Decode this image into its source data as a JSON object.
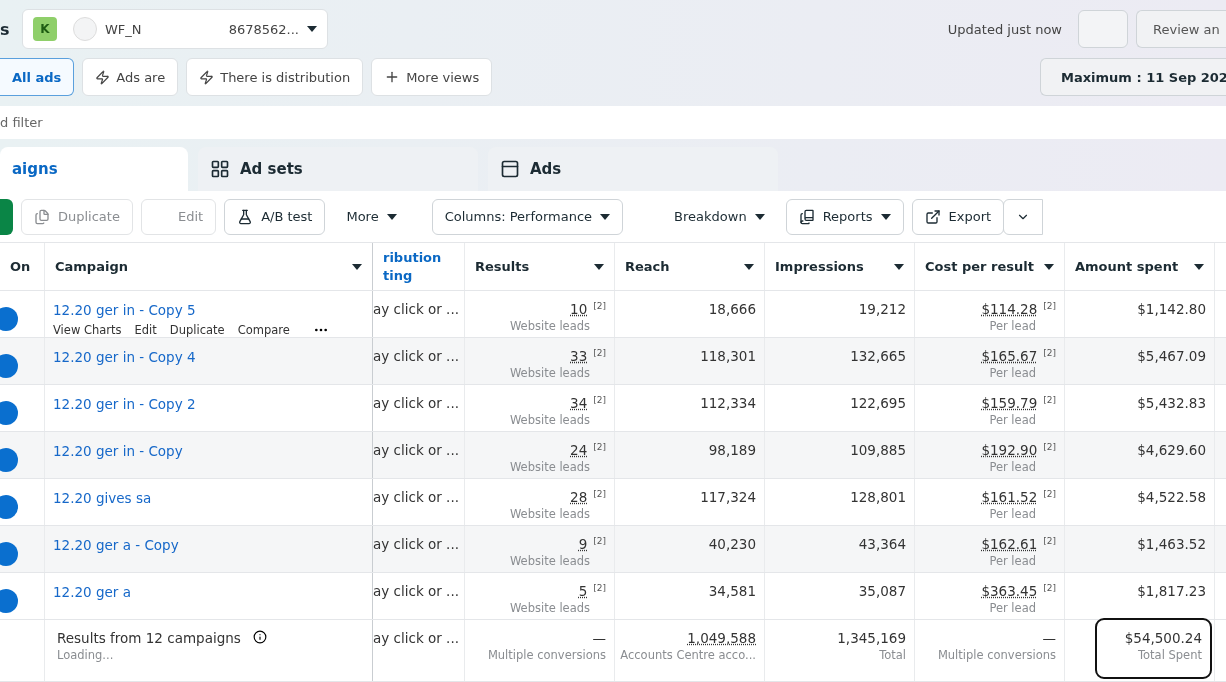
{
  "header": {
    "section_title": "s",
    "account": {
      "initial": "K",
      "name_start": "WF_N",
      "name_end": "8678562..."
    },
    "updated": "Updated just now",
    "review_button": "Review an"
  },
  "views": [
    {
      "label": "All ads",
      "kind": "plain",
      "selected": true
    },
    {
      "label": "Ads are",
      "kind": "bolt",
      "selected": false
    },
    {
      "label": "There is distribution",
      "kind": "bolt",
      "selected": false
    },
    {
      "label": "More views",
      "kind": "plus",
      "selected": false
    }
  ],
  "date_button": "Maximum : 11 Sep 202",
  "filter": {
    "placeholder": "d filter"
  },
  "tabs": [
    {
      "label": "aigns",
      "kind": "campaigns",
      "selected": true
    },
    {
      "label": "Ad sets",
      "kind": "adsets",
      "selected": false
    },
    {
      "label": "Ads",
      "kind": "ads",
      "selected": false
    }
  ],
  "toolbar": [
    {
      "kind": "create"
    },
    {
      "kind": "duplicate",
      "label": "Duplicate",
      "disabled": true
    },
    {
      "kind": "edit",
      "label": "Edit",
      "disabled": true
    },
    {
      "kind": "abtest",
      "label": "A/B test",
      "disabled": false
    },
    {
      "kind": "more",
      "label": "More",
      "disabled": false
    },
    {
      "kind": "columns",
      "label": "Columns: Performance",
      "disabled": false
    },
    {
      "kind": "breakdown",
      "label": "Breakdown",
      "disabled": false
    },
    {
      "kind": "reports",
      "label": "Reports",
      "disabled": false
    },
    {
      "kind": "export",
      "label": "Export",
      "disabled": false
    }
  ],
  "table": {
    "columns": [
      "On",
      "Campaign",
      "ribution ting",
      "Results",
      "Reach",
      "Impressions",
      "Cost per result",
      "Amount spent"
    ],
    "rows": [
      {
        "on": true,
        "campaign": "12.20 ger in - Copy 5",
        "actions": [
          "View Charts",
          "Edit",
          "Duplicate",
          "Compare"
        ],
        "attribution": "ay click or ...",
        "results": "10",
        "results_note": "[2]",
        "results_type": "Website leads",
        "reach": "18,666",
        "impressions": "19,212",
        "cost": "$114.28",
        "cost_note": "[2]",
        "cost_type": "Per lead",
        "spent": "$1,142.80"
      },
      {
        "on": true,
        "campaign": "12.20 ger in - Copy 4",
        "attribution": "ay click or ...",
        "results": "33",
        "results_note": "[2]",
        "results_type": "Website leads",
        "reach": "118,301",
        "impressions": "132,665",
        "cost": "$165.67",
        "cost_note": "[2]",
        "cost_type": "Per lead",
        "spent": "$5,467.09"
      },
      {
        "on": true,
        "campaign": "12.20 ger in - Copy 2",
        "attribution": "ay click or ...",
        "results": "34",
        "results_note": "[2]",
        "results_type": "Website leads",
        "reach": "112,334",
        "impressions": "122,695",
        "cost": "$159.79",
        "cost_note": "[2]",
        "cost_type": "Per lead",
        "spent": "$5,432.83"
      },
      {
        "on": true,
        "campaign": "12.20 ger in - Copy",
        "attribution": "ay click or ...",
        "results": "24",
        "results_note": "[2]",
        "results_type": "Website leads",
        "reach": "98,189",
        "impressions": "109,885",
        "cost": "$192.90",
        "cost_note": "[2]",
        "cost_type": "Per lead",
        "spent": "$4,629.60"
      },
      {
        "on": true,
        "campaign": "12.20 gives sa",
        "attribution": "ay click or ...",
        "results": "28",
        "results_note": "[2]",
        "results_type": "Website leads",
        "reach": "117,324",
        "impressions": "128,801",
        "cost": "$161.52",
        "cost_note": "[2]",
        "cost_type": "Per lead",
        "spent": "$4,522.58"
      },
      {
        "on": true,
        "campaign": "12.20 ger a - Copy",
        "attribution": "ay click or ...",
        "results": "9",
        "results_note": "[2]",
        "results_type": "Website leads",
        "reach": "40,230",
        "impressions": "43,364",
        "cost": "$162.61",
        "cost_note": "[2]",
        "cost_type": "Per lead",
        "spent": "$1,463.52"
      },
      {
        "on": true,
        "campaign": "12.20 ger a",
        "attribution": "ay click or ...",
        "results": "5",
        "results_note": "[2]",
        "results_type": "Website leads",
        "reach": "34,581",
        "impressions": "35,087",
        "cost": "$363.45",
        "cost_note": "[2]",
        "cost_type": "Per lead",
        "spent": "$1,817.23"
      }
    ],
    "footer": {
      "campaign": "Results from 12 campaigns",
      "status": "Loading...",
      "attribution": "ay click or ...",
      "results": "—",
      "results_type": "Multiple conversions",
      "reach": "1,049,588",
      "reach_type": "Accounts Centre acco...",
      "impressions": "1,345,169",
      "impressions_type": "Total",
      "cost": "—",
      "cost_type": "Multiple conversions",
      "spent": "$54,500.24",
      "spent_type": "Total Spent",
      "spent_highlighted": true
    }
  }
}
